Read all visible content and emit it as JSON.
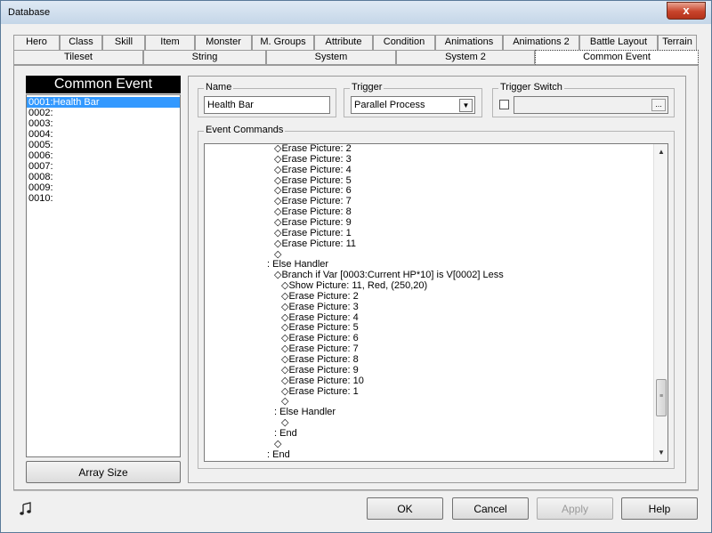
{
  "window": {
    "title": "Database"
  },
  "tabs": {
    "row1": [
      {
        "label": "Hero"
      },
      {
        "label": "Class"
      },
      {
        "label": "Skill"
      },
      {
        "label": "Item"
      },
      {
        "label": "Monster"
      },
      {
        "label": "M. Groups"
      },
      {
        "label": "Attribute"
      },
      {
        "label": "Condition"
      },
      {
        "label": "Animations"
      },
      {
        "label": "Animations 2"
      },
      {
        "label": "Battle Layout"
      },
      {
        "label": "Terrain"
      }
    ],
    "row2": [
      {
        "label": "Tileset"
      },
      {
        "label": "String"
      },
      {
        "label": "System"
      },
      {
        "label": "System 2"
      },
      {
        "label": "Common Event",
        "active": true
      }
    ]
  },
  "event_list": {
    "header": "Common Event",
    "items": [
      "0001:Health Bar",
      "0002:",
      "0003:",
      "0004:",
      "0005:",
      "0006:",
      "0007:",
      "0008:",
      "0009:",
      "0010:"
    ],
    "selected_index": 0,
    "array_size_label": "Array Size"
  },
  "fields": {
    "name_label": "Name",
    "name_value": "Health Bar",
    "trigger_label": "Trigger",
    "trigger_value": "Parallel Process",
    "trigger_switch_label": "Trigger Switch",
    "trigger_switch_button": "..."
  },
  "event_commands": {
    "label": "Event Commands",
    "lines": [
      {
        "indent": 3,
        "text": "◇Erase Picture: 2"
      },
      {
        "indent": 3,
        "text": "◇Erase Picture: 3"
      },
      {
        "indent": 3,
        "text": "◇Erase Picture: 4"
      },
      {
        "indent": 3,
        "text": "◇Erase Picture: 5"
      },
      {
        "indent": 3,
        "text": "◇Erase Picture: 6"
      },
      {
        "indent": 3,
        "text": "◇Erase Picture: 7"
      },
      {
        "indent": 3,
        "text": "◇Erase Picture: 8"
      },
      {
        "indent": 3,
        "text": "◇Erase Picture: 9"
      },
      {
        "indent": 3,
        "text": "◇Erase Picture: 1"
      },
      {
        "indent": 3,
        "text": "◇Erase Picture: 11"
      },
      {
        "indent": 3,
        "text": "◇"
      },
      {
        "indent": 2,
        "text": ": Else Handler"
      },
      {
        "indent": 3,
        "text": "◇Branch if Var [0003:Current HP*10] is V[0002] Less"
      },
      {
        "indent": 4,
        "text": "◇Show Picture: 11, Red, (250,20)"
      },
      {
        "indent": 4,
        "text": "◇Erase Picture: 2"
      },
      {
        "indent": 4,
        "text": "◇Erase Picture: 3"
      },
      {
        "indent": 4,
        "text": "◇Erase Picture: 4"
      },
      {
        "indent": 4,
        "text": "◇Erase Picture: 5"
      },
      {
        "indent": 4,
        "text": "◇Erase Picture: 6"
      },
      {
        "indent": 4,
        "text": "◇Erase Picture: 7"
      },
      {
        "indent": 4,
        "text": "◇Erase Picture: 8"
      },
      {
        "indent": 4,
        "text": "◇Erase Picture: 9"
      },
      {
        "indent": 4,
        "text": "◇Erase Picture: 10"
      },
      {
        "indent": 4,
        "text": "◇Erase Picture: 1"
      },
      {
        "indent": 4,
        "text": "◇"
      },
      {
        "indent": 3,
        "text": ": Else Handler"
      },
      {
        "indent": 4,
        "text": "◇"
      },
      {
        "indent": 3,
        "text": ": End"
      },
      {
        "indent": 3,
        "text": "◇"
      },
      {
        "indent": 2,
        "text": ": End"
      }
    ]
  },
  "buttons": {
    "ok": "OK",
    "cancel": "Cancel",
    "apply": "Apply",
    "help": "Help",
    "close": "x"
  },
  "icons": {
    "music": "music-note-icon"
  }
}
